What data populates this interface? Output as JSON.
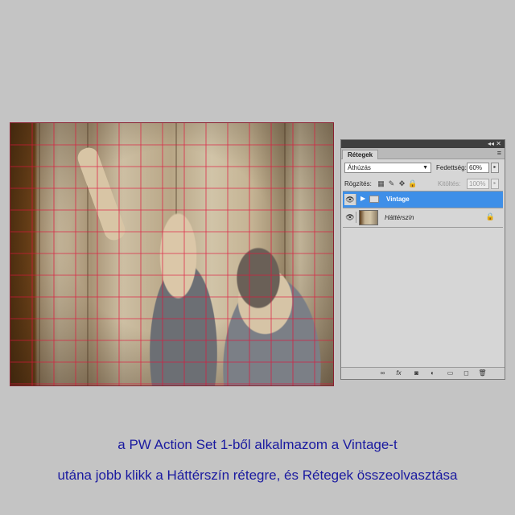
{
  "image": {
    "description_icon": "photo-of-two-children",
    "grid_color": "#e0143c"
  },
  "layers_panel": {
    "tab_label": "Rétegek",
    "top_controls": "◂◂ ✕",
    "menu_icon": "≡",
    "blend_mode": "Áthúzás",
    "opacity_label": "Fedettség:",
    "opacity_value": "60%",
    "lock_label": "Rögzítés:",
    "fill_label": "Kitöltés:",
    "fill_value": "100%",
    "layers": [
      {
        "name": "Vintage",
        "type": "group",
        "selected": true,
        "visible": true
      },
      {
        "name": "Háttérszín",
        "type": "image",
        "selected": false,
        "visible": true,
        "locked": true
      }
    ],
    "colors": {
      "selection": "#3e8fe8",
      "panel_bg": "#d6d6d6"
    }
  },
  "caption": {
    "line1": "a PW Action Set 1-ből alkalmazom a Vintage-t",
    "line2": "utána jobb klikk a Háttérszín rétegre, és Rétegek összeolvasztása",
    "color": "#1a1aa0"
  }
}
